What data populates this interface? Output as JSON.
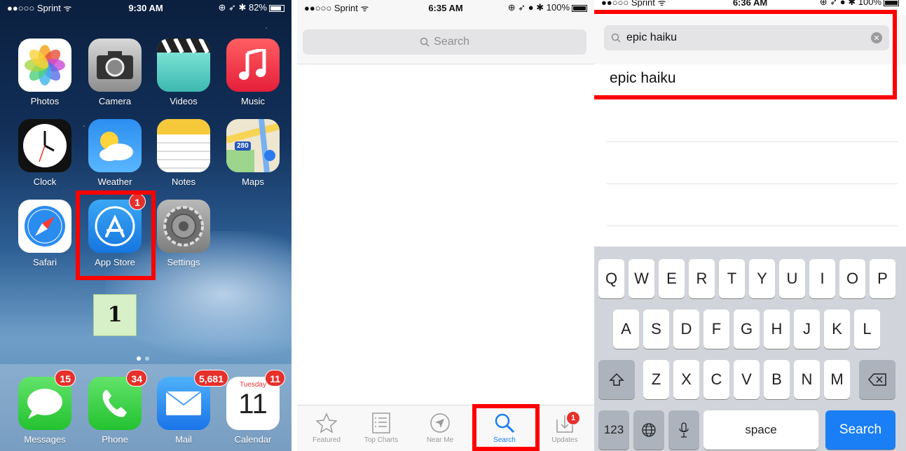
{
  "panel1": {
    "status": {
      "carrier": "●●○○○ Sprint ᯤ",
      "time": "9:30 AM",
      "right": "⊕ ➶ ✱ 82%"
    },
    "apps": [
      {
        "label": "Photos",
        "icon": "photos-icon"
      },
      {
        "label": "Camera",
        "icon": "camera-icon"
      },
      {
        "label": "Videos",
        "icon": "videos-icon"
      },
      {
        "label": "Music",
        "icon": "music-icon"
      },
      {
        "label": "Clock",
        "icon": "clock-icon"
      },
      {
        "label": "Weather",
        "icon": "weather-icon"
      },
      {
        "label": "Notes",
        "icon": "notes-icon"
      },
      {
        "label": "Maps",
        "icon": "maps-icon",
        "shield": "280"
      },
      {
        "label": "Safari",
        "icon": "safari-icon"
      },
      {
        "label": "App Store",
        "icon": "app-store-icon",
        "badge": "1"
      },
      {
        "label": "Settings",
        "icon": "settings-icon"
      }
    ],
    "step_label": "1",
    "dock": [
      {
        "label": "Messages",
        "badge": "15"
      },
      {
        "label": "Phone",
        "badge": "34"
      },
      {
        "label": "Mail",
        "badge": "5,681"
      },
      {
        "label": "Calendar",
        "badge": "11",
        "day": "Tuesday",
        "date": "11"
      }
    ]
  },
  "panel2": {
    "status": {
      "carrier": "●●○○○ Sprint ᯤ",
      "time": "6:35 AM",
      "right": "⊕ ➶ ● ✱ 100%"
    },
    "search_placeholder": "Search",
    "tabs": [
      {
        "label": "Featured",
        "icon": "star-icon"
      },
      {
        "label": "Top Charts",
        "icon": "list-icon"
      },
      {
        "label": "Near Me",
        "icon": "location-arrow-icon"
      },
      {
        "label": "Search",
        "icon": "search-icon",
        "active": true
      },
      {
        "label": "Updates",
        "icon": "download-icon",
        "badge": "1"
      }
    ]
  },
  "panel3": {
    "status": {
      "carrier": "●●○○○ Sprint ᯤ",
      "time": "6:36 AM",
      "right": "⊕ ➶ ● ✱ 100%"
    },
    "search_value": "epic haiku",
    "suggestion": "epic haiku",
    "keyboard": {
      "row1": [
        "Q",
        "W",
        "E",
        "R",
        "T",
        "Y",
        "U",
        "I",
        "O",
        "P"
      ],
      "row2": [
        "A",
        "S",
        "D",
        "F",
        "G",
        "H",
        "J",
        "K",
        "L"
      ],
      "row3": [
        "Z",
        "X",
        "C",
        "V",
        "B",
        "N",
        "M"
      ],
      "numbers_key": "123",
      "space_key": "space",
      "search_key": "Search"
    }
  },
  "colors": {
    "highlight": "#ff0000",
    "ios_blue": "#1a7ef5",
    "badge_red": "#e5302b"
  }
}
